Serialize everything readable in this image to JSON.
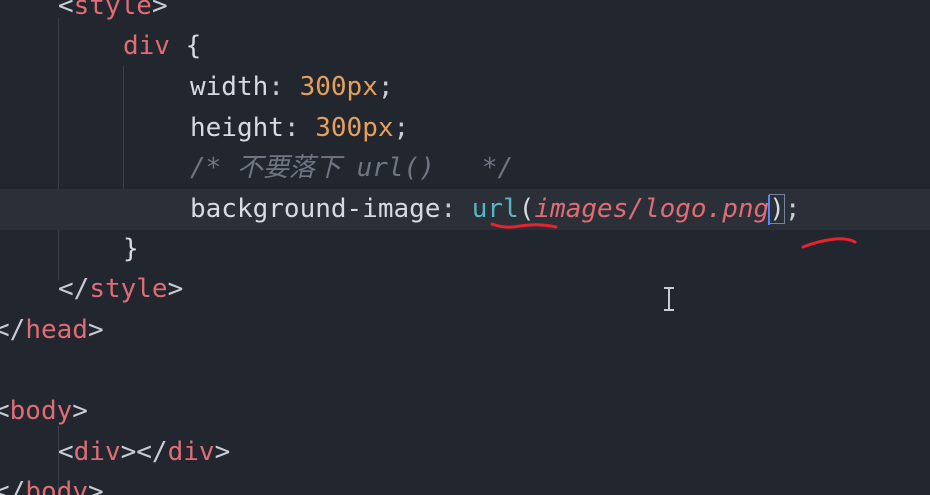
{
  "editor": {
    "lines": [
      {
        "segments": [
          {
            "cls": "punct",
            "text": "<"
          },
          {
            "cls": "tag",
            "text": "style"
          },
          {
            "cls": "punct",
            "text": ">"
          }
        ]
      },
      {
        "segments": [
          {
            "cls": "sel",
            "text": "div"
          },
          {
            "cls": "brace",
            "text": " {"
          }
        ]
      },
      {
        "segments": [
          {
            "cls": "prop",
            "text": "width"
          },
          {
            "cls": "punct",
            "text": ": "
          },
          {
            "cls": "num",
            "text": "300px"
          },
          {
            "cls": "punct",
            "text": ";"
          }
        ]
      },
      {
        "segments": [
          {
            "cls": "prop",
            "text": "height"
          },
          {
            "cls": "punct",
            "text": ": "
          },
          {
            "cls": "num",
            "text": "300px"
          },
          {
            "cls": "punct",
            "text": ";"
          }
        ]
      },
      {
        "segments": [
          {
            "cls": "comment",
            "text": "/* 不要落下 url()   */"
          }
        ]
      },
      {
        "segments": [
          {
            "cls": "prop",
            "text": "background-image"
          },
          {
            "cls": "punct",
            "text": ": "
          },
          {
            "cls": "func",
            "text": "url"
          },
          {
            "cls": "paren",
            "text": "("
          },
          {
            "cls": "str",
            "text": "images/logo.png"
          },
          {
            "cls": "caret",
            "text": ""
          },
          {
            "cls": "paren bracket-match",
            "text": ")"
          },
          {
            "cls": "punct",
            "text": ";"
          }
        ]
      },
      {
        "segments": [
          {
            "cls": "brace",
            "text": "}"
          }
        ]
      },
      {
        "segments": [
          {
            "cls": "punct",
            "text": "</"
          },
          {
            "cls": "tag",
            "text": "style"
          },
          {
            "cls": "punct",
            "text": ">"
          }
        ]
      },
      {
        "segments": [
          {
            "cls": "punct",
            "text": "</"
          },
          {
            "cls": "tag",
            "text": "head"
          },
          {
            "cls": "punct",
            "text": ">"
          }
        ]
      },
      {
        "segments": []
      },
      {
        "segments": [
          {
            "cls": "punct",
            "text": "<"
          },
          {
            "cls": "tag",
            "text": "body"
          },
          {
            "cls": "punct",
            "text": ">"
          }
        ]
      },
      {
        "segments": [
          {
            "cls": "punct",
            "text": "<"
          },
          {
            "cls": "tag",
            "text": "div"
          },
          {
            "cls": "punct",
            "text": "></"
          },
          {
            "cls": "tag",
            "text": "div"
          },
          {
            "cls": "punct",
            "text": ">"
          }
        ]
      },
      {
        "segments": [
          {
            "cls": "punct",
            "text": "</"
          },
          {
            "cls": "tag",
            "text": "body"
          },
          {
            "cls": "punct",
            "text": ">"
          }
        ]
      }
    ]
  },
  "colors": {
    "background": "#22262e",
    "active_line": "#2b3038",
    "tag": "#e06c75",
    "number": "#e5a05b",
    "function": "#56b6c2",
    "comment": "#6f7683",
    "caret": "#528bff",
    "annotation": "#e8232d"
  },
  "icons": {
    "cursor": "text-ibeam-icon"
  }
}
